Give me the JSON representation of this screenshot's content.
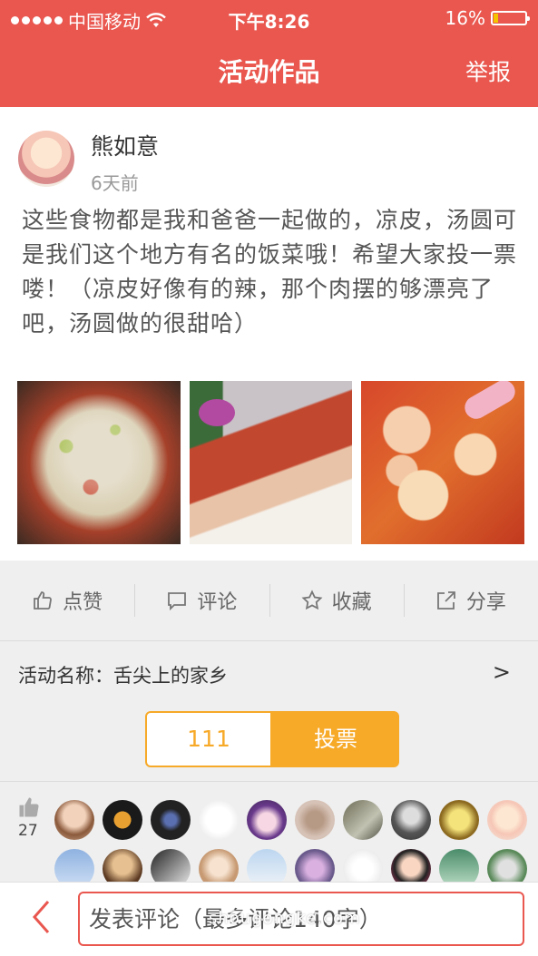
{
  "status_bar": {
    "carrier": "中国移动",
    "time": "下午8:26",
    "battery": "16%",
    "battery_level": 0.16
  },
  "nav": {
    "title": "活动作品",
    "report_label": "举报"
  },
  "post": {
    "author": "熊如意",
    "time_ago": "6天前",
    "content": "这些食物都是我和爸爸一起做的，凉皮，汤圆可是我们这个地方有名的饭菜哦！希望大家投一票喽！（凉皮好像有的辣，那个肉摆的够漂亮了吧，汤圆做的很甜哈）",
    "photos": [
      "liangpi-photo",
      "roast-pork-photo",
      "tangyuan-photo"
    ]
  },
  "actions": [
    {
      "label": "点赞",
      "icon": "thumbs-up-icon"
    },
    {
      "label": "评论",
      "icon": "comment-icon"
    },
    {
      "label": "收藏",
      "icon": "star-icon"
    },
    {
      "label": "分享",
      "icon": "share-icon"
    }
  ],
  "activity": {
    "name": "活动名称：舌尖上的家乡",
    "chevron": ">"
  },
  "vote": {
    "count": "111",
    "button_label": "投票"
  },
  "likes": {
    "count": "27"
  },
  "comment_bar": {
    "placeholder": "发表评论（最多评论140字）",
    "back_icon": "chevron-left-icon"
  },
  "watermark": {
    "domain": "shougongke.com",
    "brand": "手工客"
  },
  "colors": {
    "brand_red": "#e9574f",
    "vote_orange": "#f7a928"
  }
}
